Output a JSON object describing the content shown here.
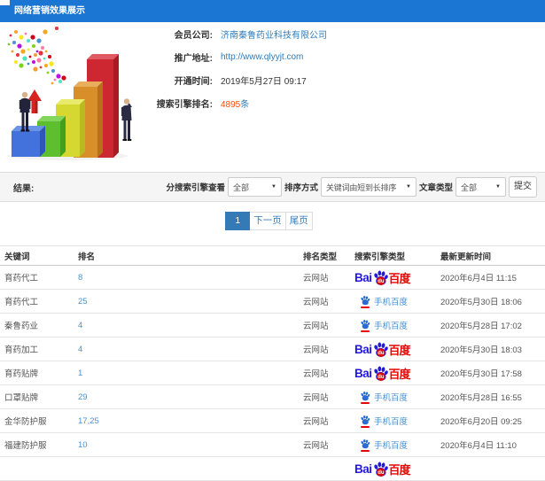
{
  "title_bar": {
    "title": "网络营销效果展示"
  },
  "info": {
    "rows": [
      {
        "label": "会员公司:",
        "value": "济南秦鲁药业科技有限公司",
        "style": "link"
      },
      {
        "label": "推广地址:",
        "value": "http://www.qlyyjt.com",
        "style": "link"
      },
      {
        "label": "开通时间:",
        "value": "2019年5月27日 09:17",
        "style": "text"
      },
      {
        "label": "搜索引擎排名:",
        "value": "4895",
        "suffix": "条",
        "style": "count"
      }
    ]
  },
  "filters": {
    "result_label": "结果:",
    "engine_label": "分搜索引擎查看",
    "engine_value": "全部",
    "sort_label": "排序方式",
    "sort_value": "关键词由短到长排序",
    "article_label": "文章类型",
    "article_value": "全部",
    "submit_label": "提交"
  },
  "pagination": {
    "current": "1",
    "next": "下一页",
    "last": "尾页"
  },
  "table": {
    "headers": [
      "关键词",
      "排名",
      "排名类型",
      "搜索引擎类型",
      "最新更新时间"
    ],
    "engine_labels": {
      "baidu_bai": "Bai",
      "baidu_du": "du",
      "baidu_cn": "百度",
      "mobile_text": "手机百度"
    },
    "rows": [
      {
        "keyword": "育药代工",
        "rank": "8",
        "rank_type": "云网站",
        "engine": "baidu",
        "updated": "2020年6月4日 11:15"
      },
      {
        "keyword": "育药代工",
        "rank": "25",
        "rank_type": "云网站",
        "engine": "mobile-baidu",
        "updated": "2020年5月30日 18:06"
      },
      {
        "keyword": "秦鲁药业",
        "rank": "4",
        "rank_type": "云网站",
        "engine": "mobile-baidu",
        "updated": "2020年5月28日 17:02"
      },
      {
        "keyword": "育药加工",
        "rank": "4",
        "rank_type": "云网站",
        "engine": "baidu",
        "updated": "2020年5月30日 18:03"
      },
      {
        "keyword": "育药贴牌",
        "rank": "1",
        "rank_type": "云网站",
        "engine": "baidu",
        "updated": "2020年5月30日 17:58"
      },
      {
        "keyword": "口罩贴牌",
        "rank": "29",
        "rank_type": "云网站",
        "engine": "mobile-baidu",
        "updated": "2020年5月28日 16:55"
      },
      {
        "keyword": "金华防护服",
        "rank": "17,25",
        "rank_type": "云网站",
        "engine": "mobile-baidu",
        "updated": "2020年6月20日 09:25"
      },
      {
        "keyword": "福建防护服",
        "rank": "10",
        "rank_type": "云网站",
        "engine": "mobile-baidu",
        "updated": "2020年6月4日 11:10"
      },
      {
        "keyword": "",
        "rank": "",
        "rank_type": "",
        "engine": "baidu",
        "updated": ""
      }
    ]
  },
  "colors": {
    "titlebar_blue": "#1a76d2",
    "link_blue": "#2e7cba",
    "count_red": "#ff4a00",
    "pagination_blue": "#337ab7",
    "baidu_blue": "#2319dc",
    "baidu_red": "#e10601"
  }
}
